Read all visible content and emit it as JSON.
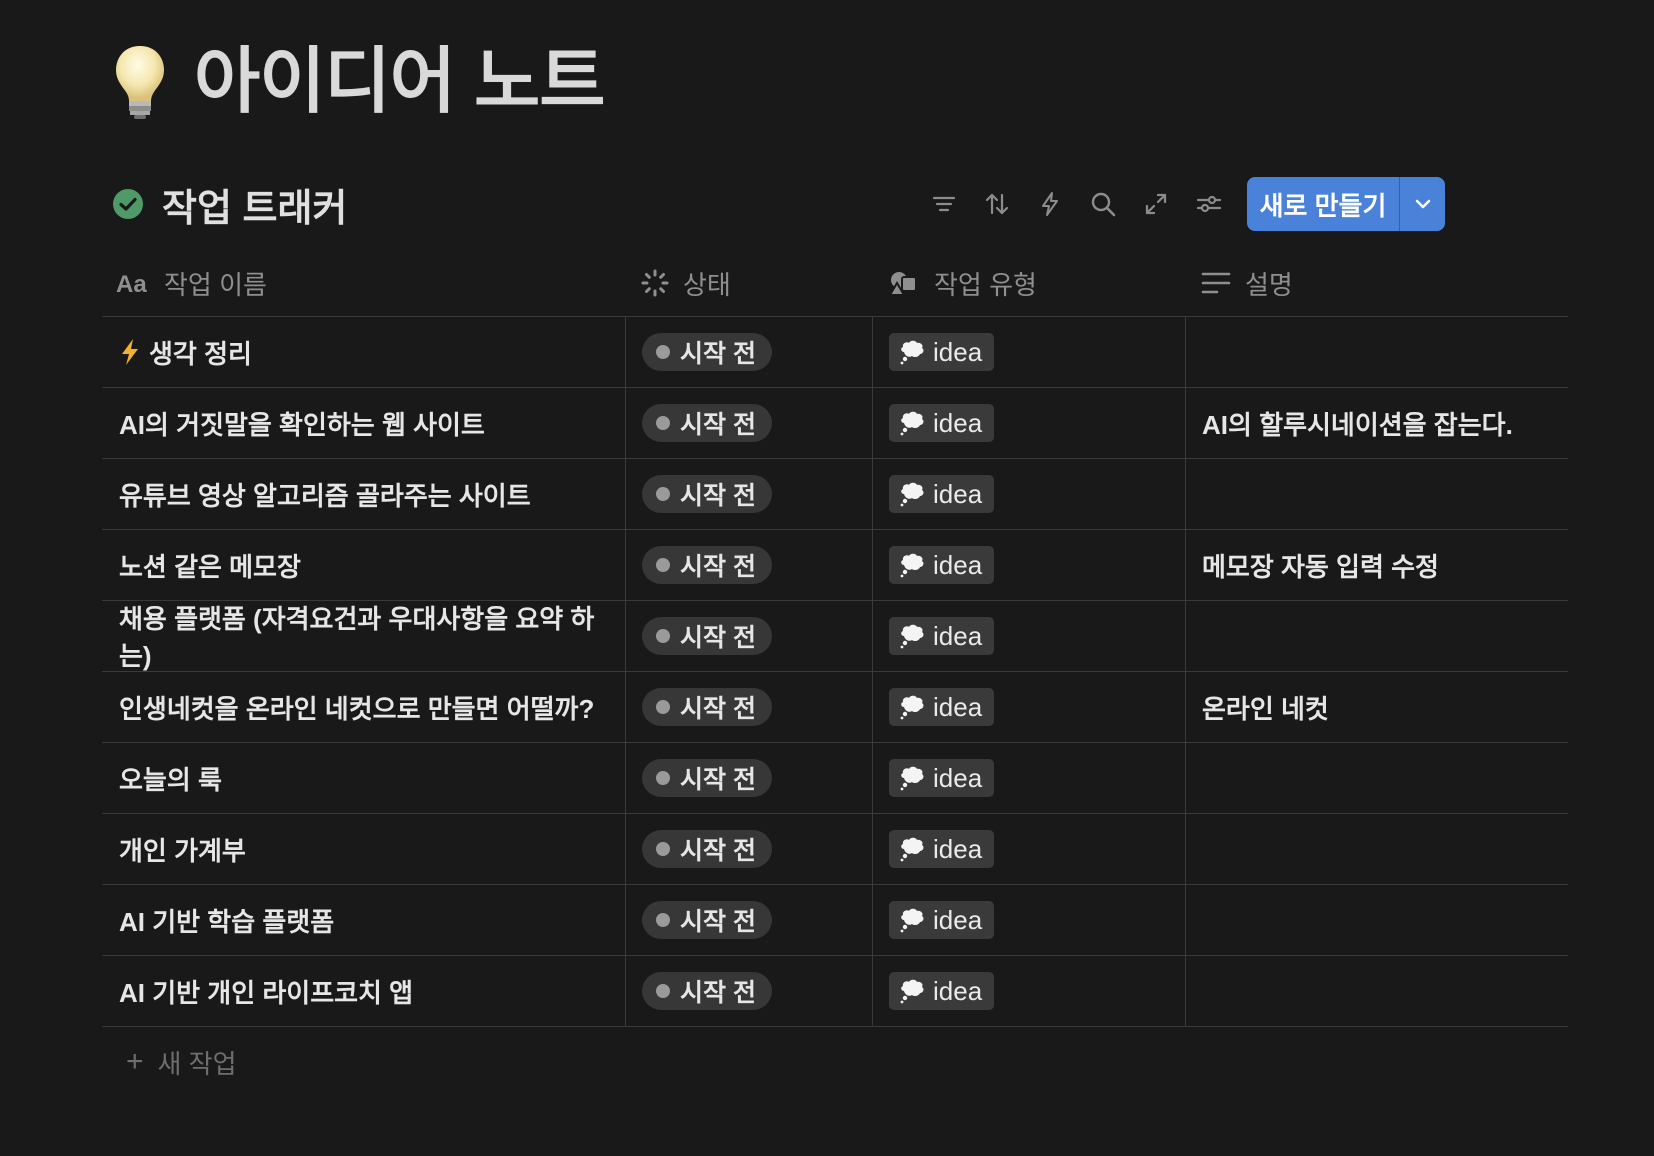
{
  "page": {
    "icon": "lightbulb-icon",
    "title": "아이디어 노트"
  },
  "database": {
    "icon": "check-circle-icon",
    "title": "작업 트래커",
    "toolbar": {
      "icons": [
        "filter-icon",
        "sort-icon",
        "lightning-icon",
        "search-icon",
        "expand-icon",
        "settings-icon"
      ],
      "new_button": "새로 만들기"
    }
  },
  "columns": [
    {
      "label": "작업 이름",
      "icon": "text-aa-icon"
    },
    {
      "label": "상태",
      "icon": "status-spinner-icon"
    },
    {
      "label": "작업 유형",
      "icon": "shapes-icon"
    },
    {
      "label": "설명",
      "icon": "lines-icon"
    }
  ],
  "rows": [
    {
      "emoji": "lightning-icon",
      "name": "생각 정리",
      "status": "시작 전",
      "type": "idea",
      "desc": ""
    },
    {
      "name": "AI의 거짓말을 확인하는 웹 사이트",
      "status": "시작 전",
      "type": "idea",
      "desc": "AI의 할루시네이션을 잡는다."
    },
    {
      "name": "유튜브 영상 알고리즘 골라주는 사이트",
      "status": "시작 전",
      "type": "idea",
      "desc": ""
    },
    {
      "name": "노션 같은 메모장",
      "status": "시작 전",
      "type": "idea",
      "desc": "메모장 자동 입력 수정"
    },
    {
      "name": "채용 플랫폼 (자격요건과 우대사항을 요약 하는)",
      "status": "시작 전",
      "type": "idea",
      "desc": ""
    },
    {
      "name": "인생네컷을 온라인 네컷으로 만들면 어떨까?",
      "status": "시작 전",
      "type": "idea",
      "desc": "온라인 네컷"
    },
    {
      "name": "오늘의 룩",
      "status": "시작 전",
      "type": "idea",
      "desc": ""
    },
    {
      "name": "개인 가계부",
      "status": "시작 전",
      "type": "idea",
      "desc": ""
    },
    {
      "name": "AI 기반 학습 플랫폼",
      "status": "시작 전",
      "type": "idea",
      "desc": ""
    },
    {
      "name": "AI 기반 개인 라이프코치 앱",
      "status": "시작 전",
      "type": "idea",
      "desc": ""
    }
  ],
  "add_row_label": "새 작업",
  "colors": {
    "background": "#191919",
    "accent": "#4a82da",
    "check_green": "#4f9a67"
  }
}
